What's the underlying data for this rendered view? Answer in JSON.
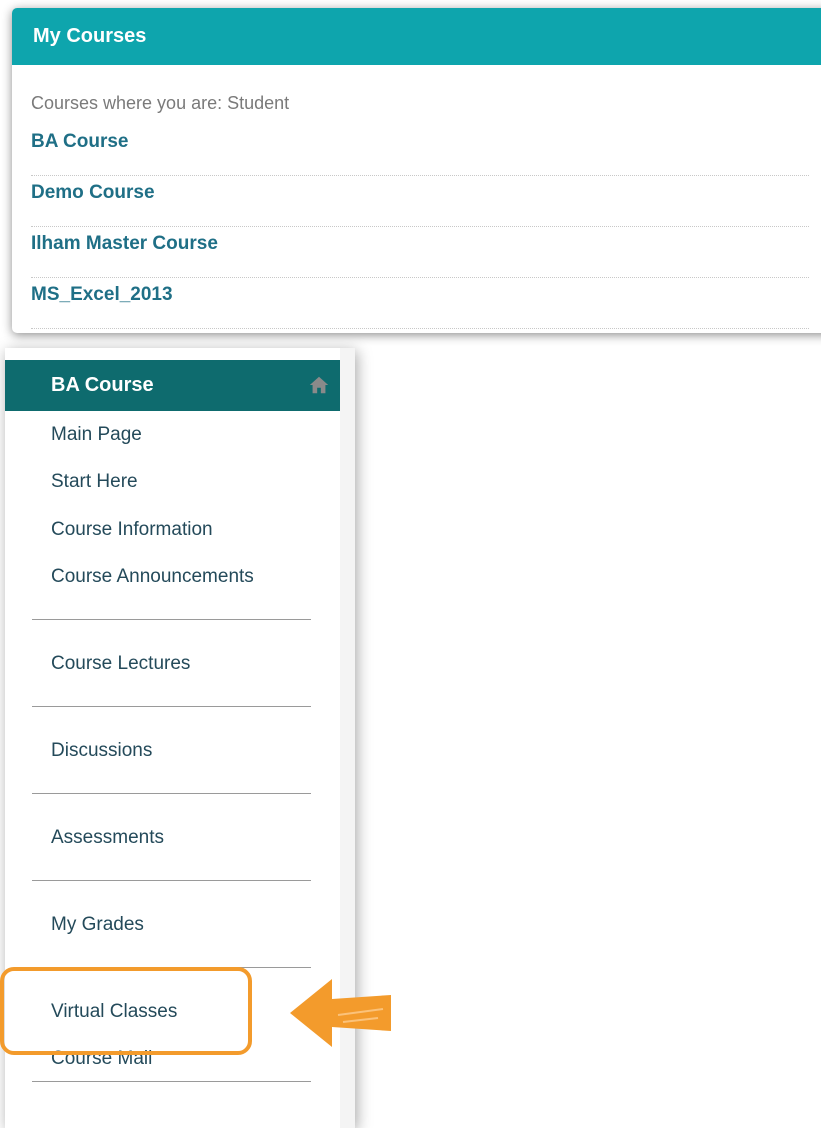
{
  "my_courses": {
    "title": "My Courses",
    "subtitle": "Courses where you are: Student",
    "courses": [
      "BA Course",
      "Demo Course",
      "Ilham Master Course",
      "MS_Excel_2013"
    ]
  },
  "course_menu": {
    "title": "BA Course",
    "home_icon": "home-icon",
    "items": [
      "Main Page",
      "Start Here",
      "Course Information",
      "Course Announcements",
      "Course Lectures",
      "Discussions",
      "Assessments",
      "My Grades",
      "Virtual Classes",
      "Course Mail"
    ]
  },
  "annotation": {
    "highlight_color": "#f39b2c",
    "pointer": "arrow-left-icon"
  },
  "colors": {
    "courses_header": "#0ea5ad",
    "menu_header": "#0e6b6e",
    "course_link": "#1f6f86",
    "menu_text": "#244a5a"
  }
}
